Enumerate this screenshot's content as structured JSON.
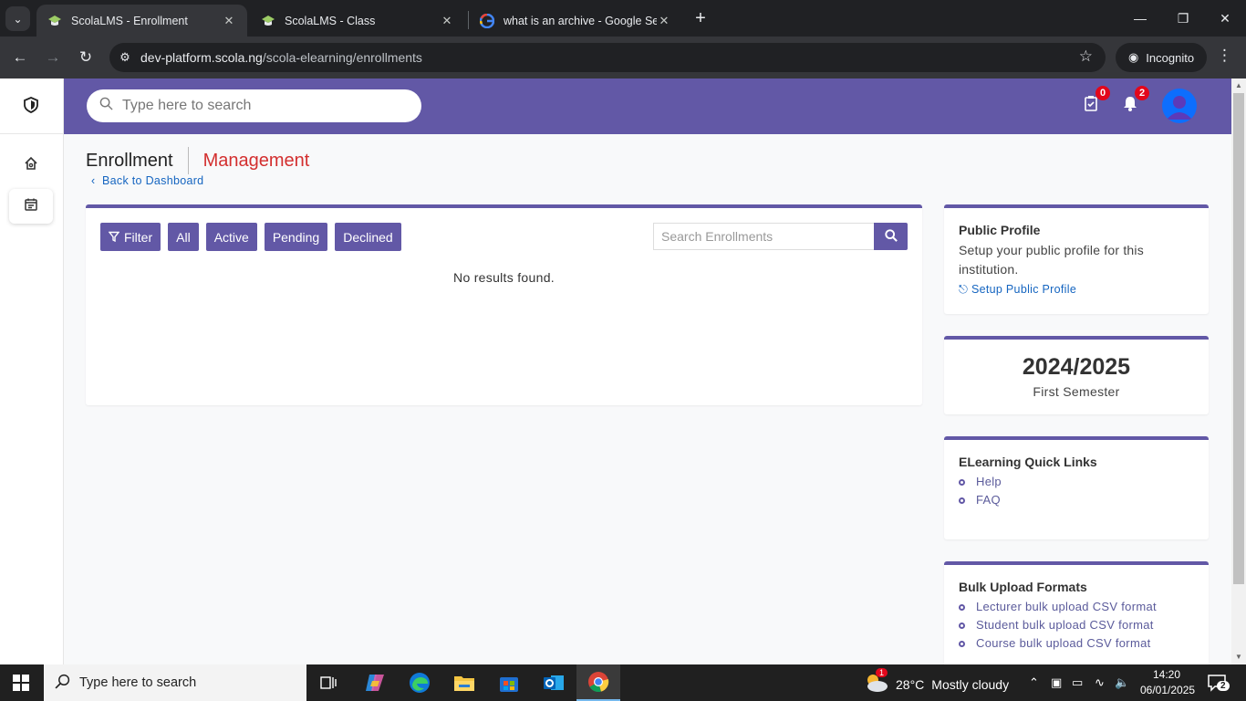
{
  "browser": {
    "tabs": [
      {
        "title": "ScolaLMS - Enrollment",
        "active": true
      },
      {
        "title": "ScolaLMS - Class",
        "active": false
      },
      {
        "title": "what is an archive - Google Search",
        "active": false
      }
    ],
    "url_host": "dev-platform.scola.ng",
    "url_path": "/scola-elearning/enrollments",
    "profile_label": "Incognito"
  },
  "app": {
    "search_placeholder": "Type here to search",
    "tasks_badge": "0",
    "notifications_badge": "2",
    "brand_color": "#6258a6"
  },
  "page": {
    "title_left": "Enrollment",
    "title_right": "Management",
    "back_link": "Back to Dashboard"
  },
  "enrollments": {
    "filters": [
      "Filter",
      "All",
      "Active",
      "Pending",
      "Declined"
    ],
    "search_placeholder": "Search Enrollments",
    "empty_message": "No results found."
  },
  "public_profile": {
    "heading": "Public Profile",
    "description": "Setup your public profile for this institution.",
    "link": "Setup Public Profile"
  },
  "session": {
    "year": "2024/2025",
    "term": "First Semester"
  },
  "quick_links": {
    "heading": "ELearning Quick Links",
    "items": [
      "Help",
      "FAQ"
    ]
  },
  "bulk_upload": {
    "heading": "Bulk Upload Formats",
    "items": [
      "Lecturer bulk upload CSV format",
      "Student bulk upload CSV format",
      "Course bulk upload CSV format"
    ]
  },
  "taskbar": {
    "search_placeholder": "Type here to search",
    "weather_temp": "28°C",
    "weather_desc": "Mostly cloudy",
    "weather_badge": "1",
    "time": "14:20",
    "date": "06/01/2025",
    "notification_count": "2"
  }
}
